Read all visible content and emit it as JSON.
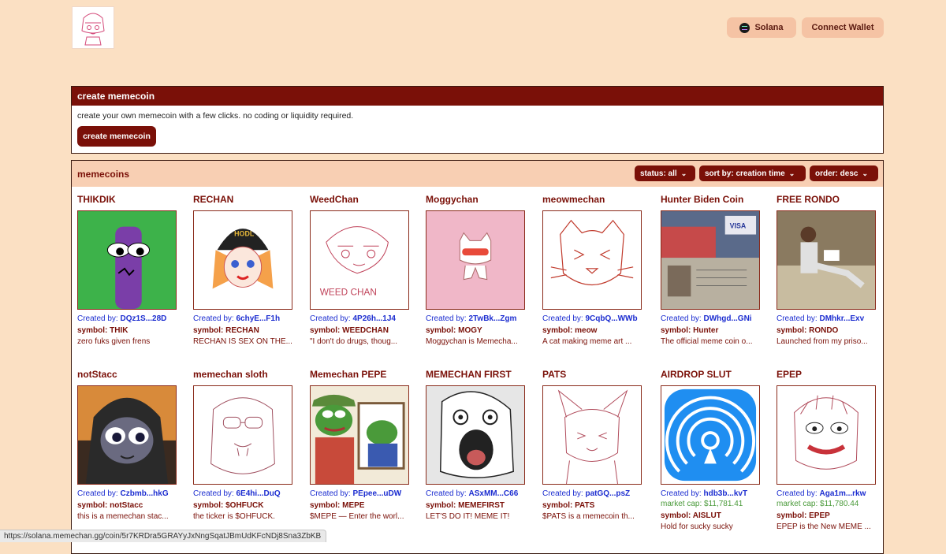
{
  "header": {
    "network_label": "Solana",
    "wallet_label": "Connect Wallet"
  },
  "create": {
    "title": "create memecoin",
    "description": "create your own memecoin with a few clicks. no coding or liquidity required.",
    "button": "create memecoin"
  },
  "list": {
    "title": "memecoins",
    "filters": {
      "status": "status: all",
      "sort": "sort by: creation time",
      "order": "order: desc"
    }
  },
  "created_prefix": "Created by:",
  "coins": [
    {
      "name": "THIKDIK",
      "creator": "DQz1S...28D",
      "symbol": "symbol: THIK",
      "desc": "zero fuks given frens",
      "image": "purple-creature"
    },
    {
      "name": "RECHAN",
      "creator": "6chyE...F1h",
      "symbol": "symbol: RECHAN",
      "desc": "RECHAN IS SEX ON THE...",
      "image": "clown-anime-girl"
    },
    {
      "name": "WeedChan",
      "creator": "4P26h...1J4",
      "symbol": "symbol: WEEDCHAN",
      "desc": "\"I don't do drugs, thoug...",
      "image": "weedchan-sketch"
    },
    {
      "name": "Moggychan",
      "creator": "2TwBk...Zgm",
      "symbol": "symbol: MOGY",
      "desc": "Moggychan is Memecha...",
      "image": "pink-cat"
    },
    {
      "name": "meowmechan",
      "creator": "9CqbQ...WWb",
      "symbol": "symbol: meow",
      "desc": "A cat making meme art ...",
      "image": "cat-sketch"
    },
    {
      "name": "Hunter Biden Coin",
      "creator": "DWhgd...GNi",
      "symbol": "symbol: Hunter",
      "desc": "The official meme coin o...",
      "image": "passport-photo"
    },
    {
      "name": "FREE RONDO",
      "creator": "DMhkr...Exv",
      "symbol": "symbol: RONDO",
      "desc": "Launched from my priso...",
      "image": "man-reading-photo"
    },
    {
      "name": "notStacc",
      "creator": "Czbmb...hkG",
      "symbol": "symbol: notStacc",
      "desc": "this is a memechan stac...",
      "image": "hooded-frog"
    },
    {
      "name": "memechan sloth",
      "creator": "6E4hi...DuQ",
      "symbol": "symbol: $OHFUCK",
      "desc": "the ticker is $OHFUCK.",
      "image": "sloth-sketch"
    },
    {
      "name": "Memechan PEPE",
      "creator": "PEpee...uDW",
      "symbol": "symbol: MEPE",
      "desc": "$MEPE — Enter the worl...",
      "image": "pepe-painter"
    },
    {
      "name": "MEMECHAN FIRST",
      "creator": "ASxMM...C66",
      "symbol": "symbol: MEMEFIRST",
      "desc": "LET'S DO IT! MEME IT!",
      "image": "rage-face"
    },
    {
      "name": "PATS",
      "creator": "patGQ...psZ",
      "symbol": "symbol: PATS",
      "desc": "$PATS is a memecoin th...",
      "image": "fox-girl-sketch"
    },
    {
      "name": "AIRDROP SLUT",
      "creator": "hdb3b...kvT",
      "mcap": "market cap: $11,781.41",
      "symbol": "symbol: AISLUT",
      "desc": "Hold for sucky sucky",
      "image": "airdrop-icon"
    },
    {
      "name": "EPEP",
      "creator": "Aga1m...rkw",
      "mcap": "market cap: $11,780.44",
      "symbol": "symbol: EPEP",
      "desc": "EPEP is the New MEME ...",
      "image": "epep-sketch"
    }
  ],
  "status_url": "https://solana.memechan.gg/coin/5r7KRDra5GRAYyJxNngSqatJBmUdKFcNDj8Sna3ZbKB",
  "colors": {
    "accent": "#7a1008",
    "background": "#fbe0c3",
    "link": "#1c2dd0",
    "mcap": "#4a9a3a"
  }
}
